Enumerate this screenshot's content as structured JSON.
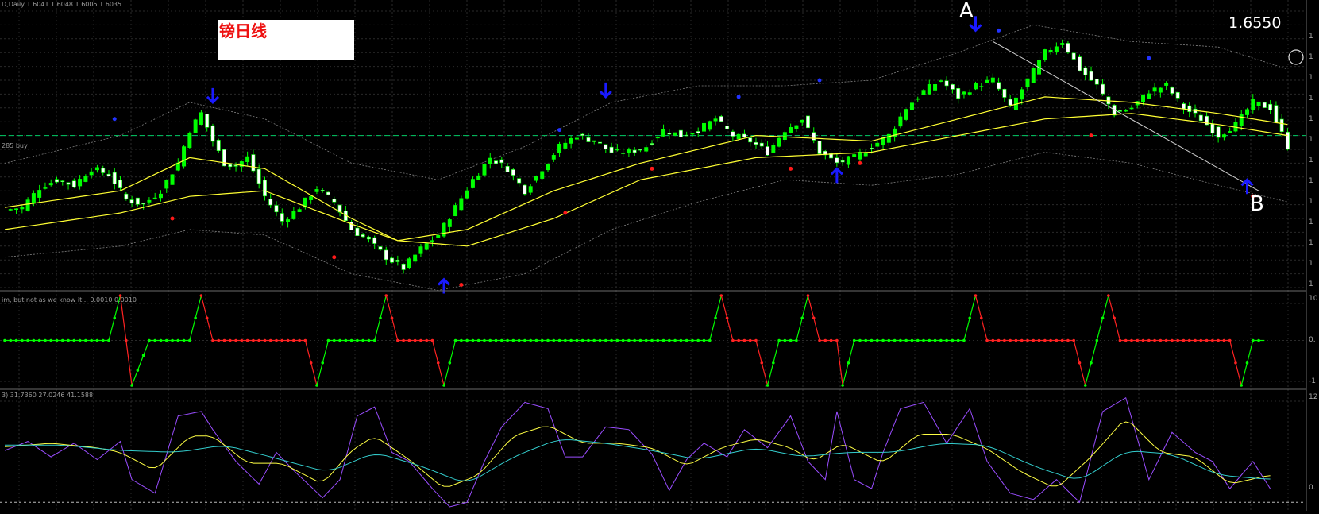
{
  "window": {
    "symbol_info": "D,Daily  1.6041 1.6048 1.6005 1.6035",
    "annotation_box": "镑日线",
    "price_label": "1.6550",
    "marker_a": "A",
    "marker_b": "B",
    "hline_label": "285 buy"
  },
  "indicator1": {
    "header": "im, but not as we know it...  0.0010  0.0010",
    "scale": [
      "10",
      "0.",
      "-1"
    ]
  },
  "indicator2": {
    "header": "3) 31.7360 27.0246 41.1588",
    "scale": [
      "12",
      "0."
    ]
  },
  "price_scale": [
    "1",
    "1",
    "1",
    "1",
    "1",
    "1",
    "1",
    "1",
    "1",
    "1",
    "1",
    "1",
    "1"
  ],
  "colors": {
    "background": "#000000",
    "grid": "#2a2a2a",
    "bull_candle": "#00ff00",
    "bear_candle": "#ffffff",
    "ma_yellow": "#ffff33",
    "band_dotted": "#808080",
    "signal_arrow": "#1a1aff",
    "dot_blue": "#2233ff",
    "dot_red": "#ff1a1a",
    "hline_green": "#00cc66",
    "hline_red": "#cc2222",
    "ind_green": "#00ff00",
    "ind_red": "#ff2222",
    "stoch_purple": "#9a4dff",
    "stoch_yellow": "#ffff44",
    "stoch_cyan": "#33cccc"
  },
  "chart_data": {
    "type": "candlestick",
    "close_path": [
      [
        0,
        1.585
      ],
      [
        3,
        1.5855
      ],
      [
        6,
        1.589
      ],
      [
        9,
        1.5905
      ],
      [
        12,
        1.5895
      ],
      [
        15,
        1.5925
      ],
      [
        18,
        1.5915
      ],
      [
        21,
        1.587
      ],
      [
        24,
        1.586
      ],
      [
        27,
        1.5885
      ],
      [
        30,
        1.5935
      ],
      [
        32,
        1.5995
      ],
      [
        34,
        1.6025
      ],
      [
        36,
        1.5975
      ],
      [
        38,
        1.5935
      ],
      [
        40,
        1.593
      ],
      [
        42,
        1.5945
      ],
      [
        45,
        1.5875
      ],
      [
        48,
        1.583
      ],
      [
        51,
        1.5855
      ],
      [
        54,
        1.589
      ],
      [
        57,
        1.5865
      ],
      [
        60,
        1.5815
      ],
      [
        63,
        1.5795
      ],
      [
        66,
        1.5765
      ],
      [
        69,
        1.5745
      ],
      [
        72,
        1.578
      ],
      [
        75,
        1.5805
      ],
      [
        78,
        1.5855
      ],
      [
        81,
        1.5905
      ],
      [
        84,
        1.5945
      ],
      [
        87,
        1.5925
      ],
      [
        90,
        1.5885
      ],
      [
        93,
        1.5925
      ],
      [
        96,
        1.5965
      ],
      [
        99,
        1.5985
      ],
      [
        102,
        1.5975
      ],
      [
        105,
        1.5955
      ],
      [
        108,
        1.5955
      ],
      [
        111,
        1.5965
      ],
      [
        114,
        1.5995
      ],
      [
        117,
        1.5985
      ],
      [
        120,
        1.5995
      ],
      [
        123,
        1.6015
      ],
      [
        126,
        1.5985
      ],
      [
        129,
        1.5975
      ],
      [
        132,
        1.5955
      ],
      [
        135,
        1.5995
      ],
      [
        138,
        1.6015
      ],
      [
        141,
        1.5955
      ],
      [
        144,
        1.5935
      ],
      [
        147,
        1.5945
      ],
      [
        150,
        1.5965
      ],
      [
        153,
        1.5985
      ],
      [
        156,
        1.6035
      ],
      [
        159,
        1.6065
      ],
      [
        162,
        1.6085
      ],
      [
        165,
        1.6055
      ],
      [
        168,
        1.6075
      ],
      [
        171,
        1.6085
      ],
      [
        174,
        1.6035
      ],
      [
        177,
        1.6085
      ],
      [
        180,
        1.6135
      ],
      [
        183,
        1.6155
      ],
      [
        186,
        1.6105
      ],
      [
        189,
        1.6075
      ],
      [
        192,
        1.6025
      ],
      [
        195,
        1.6035
      ],
      [
        198,
        1.6065
      ],
      [
        201,
        1.6075
      ],
      [
        204,
        1.6035
      ],
      [
        207,
        1.6015
      ],
      [
        210,
        1.5985
      ],
      [
        213,
        1.6005
      ],
      [
        216,
        1.6045
      ],
      [
        219,
        1.6035
      ],
      [
        222,
        1.5965
      ]
    ],
    "ma_fast": [
      [
        0,
        1.5855
      ],
      [
        20,
        1.5885
      ],
      [
        32,
        1.5945
      ],
      [
        45,
        1.5925
      ],
      [
        60,
        1.5835
      ],
      [
        68,
        1.5795
      ],
      [
        80,
        1.5815
      ],
      [
        95,
        1.5885
      ],
      [
        110,
        1.5935
      ],
      [
        130,
        1.5985
      ],
      [
        150,
        1.5975
      ],
      [
        165,
        1.6015
      ],
      [
        180,
        1.6055
      ],
      [
        195,
        1.6045
      ],
      [
        210,
        1.6025
      ],
      [
        222,
        1.6005
      ]
    ],
    "ma_slow": [
      [
        0,
        1.5815
      ],
      [
        20,
        1.5845
      ],
      [
        32,
        1.5875
      ],
      [
        45,
        1.5885
      ],
      [
        60,
        1.5825
      ],
      [
        68,
        1.5795
      ],
      [
        80,
        1.5785
      ],
      [
        95,
        1.5835
      ],
      [
        110,
        1.5905
      ],
      [
        130,
        1.5945
      ],
      [
        150,
        1.5955
      ],
      [
        165,
        1.5985
      ],
      [
        180,
        1.6015
      ],
      [
        195,
        1.6025
      ],
      [
        210,
        1.6005
      ],
      [
        222,
        1.5985
      ]
    ],
    "band_upper": [
      [
        0,
        1.5935
      ],
      [
        20,
        1.5985
      ],
      [
        32,
        1.6045
      ],
      [
        45,
        1.6015
      ],
      [
        60,
        1.5935
      ],
      [
        75,
        1.5905
      ],
      [
        90,
        1.5965
      ],
      [
        105,
        1.6045
      ],
      [
        120,
        1.6075
      ],
      [
        135,
        1.6075
      ],
      [
        150,
        1.6085
      ],
      [
        165,
        1.6135
      ],
      [
        178,
        1.6185
      ],
      [
        195,
        1.6155
      ],
      [
        210,
        1.6145
      ],
      [
        222,
        1.6105
      ]
    ],
    "band_lower": [
      [
        0,
        1.5765
      ],
      [
        20,
        1.5785
      ],
      [
        32,
        1.5815
      ],
      [
        45,
        1.5805
      ],
      [
        60,
        1.5735
      ],
      [
        75,
        1.5705
      ],
      [
        90,
        1.5735
      ],
      [
        105,
        1.5815
      ],
      [
        120,
        1.5865
      ],
      [
        135,
        1.5905
      ],
      [
        150,
        1.5895
      ],
      [
        165,
        1.5915
      ],
      [
        180,
        1.5955
      ],
      [
        195,
        1.5935
      ],
      [
        210,
        1.5895
      ],
      [
        222,
        1.5865
      ]
    ],
    "hline_green": 1.5985,
    "hline_red": 1.5975,
    "y_range": [
      1.571,
      1.621
    ],
    "x_range": [
      0,
      224
    ],
    "arrows_down": [
      [
        36,
        1.6045
      ],
      [
        104,
        1.6055
      ],
      [
        168,
        1.6175
      ]
    ],
    "arrows_up": [
      [
        76,
        1.5725
      ],
      [
        144,
        1.5925
      ],
      [
        215,
        1.5905
      ]
    ],
    "dots_blue": [
      [
        19,
        1.6015
      ],
      [
        96,
        1.5995
      ],
      [
        127,
        1.6055
      ],
      [
        141,
        1.6085
      ],
      [
        172,
        1.6175
      ],
      [
        198,
        1.6125
      ]
    ],
    "dots_red": [
      [
        29,
        1.5835
      ],
      [
        57,
        1.5765
      ],
      [
        79,
        1.5715
      ],
      [
        97,
        1.5845
      ],
      [
        112,
        1.5925
      ],
      [
        136,
        1.5925
      ],
      [
        148,
        1.5935
      ],
      [
        188,
        1.5985
      ],
      [
        216,
        1.5875
      ]
    ],
    "trendline": [
      [
        171,
        1.6155
      ],
      [
        217,
        1.5885
      ]
    ],
    "indicator1_line": [
      [
        0,
        0
      ],
      [
        18,
        0
      ],
      [
        20,
        10
      ],
      [
        22,
        -10
      ],
      [
        25,
        0
      ],
      [
        32,
        0
      ],
      [
        34,
        10
      ],
      [
        36,
        0
      ],
      [
        52,
        0
      ],
      [
        54,
        -10
      ],
      [
        56,
        0
      ],
      [
        64,
        0
      ],
      [
        66,
        10
      ],
      [
        68,
        0
      ],
      [
        74,
        0
      ],
      [
        76,
        -10
      ],
      [
        78,
        0
      ],
      [
        122,
        0
      ],
      [
        124,
        10
      ],
      [
        126,
        0
      ],
      [
        130,
        0
      ],
      [
        132,
        -10
      ],
      [
        134,
        0
      ],
      [
        137,
        0
      ],
      [
        139,
        10
      ],
      [
        141,
        0
      ],
      [
        144,
        0
      ],
      [
        145,
        -10
      ],
      [
        147,
        0
      ],
      [
        166,
        0
      ],
      [
        168,
        10
      ],
      [
        170,
        0
      ],
      [
        185,
        0
      ],
      [
        187,
        -10
      ],
      [
        189,
        0
      ],
      [
        191,
        10
      ],
      [
        193,
        0
      ],
      [
        212,
        0
      ],
      [
        214,
        -10
      ],
      [
        216,
        0
      ],
      [
        218,
        0
      ]
    ],
    "indicator2_purple": [
      [
        0,
        62
      ],
      [
        4,
        72
      ],
      [
        8,
        55
      ],
      [
        12,
        70
      ],
      [
        16,
        52
      ],
      [
        20,
        72
      ],
      [
        22,
        30
      ],
      [
        26,
        15
      ],
      [
        30,
        100
      ],
      [
        34,
        105
      ],
      [
        36,
        85
      ],
      [
        40,
        50
      ],
      [
        44,
        25
      ],
      [
        47,
        60
      ],
      [
        50,
        40
      ],
      [
        55,
        10
      ],
      [
        58,
        30
      ],
      [
        61,
        100
      ],
      [
        64,
        110
      ],
      [
        67,
        60
      ],
      [
        70,
        50
      ],
      [
        74,
        20
      ],
      [
        77,
        0
      ],
      [
        80,
        5
      ],
      [
        83,
        50
      ],
      [
        86,
        88
      ],
      [
        90,
        115
      ],
      [
        94,
        108
      ],
      [
        97,
        55
      ],
      [
        100,
        55
      ],
      [
        104,
        88
      ],
      [
        108,
        85
      ],
      [
        112,
        58
      ],
      [
        115,
        18
      ],
      [
        118,
        52
      ],
      [
        121,
        70
      ],
      [
        125,
        55
      ],
      [
        128,
        85
      ],
      [
        132,
        65
      ],
      [
        136,
        100
      ],
      [
        139,
        50
      ],
      [
        142,
        30
      ],
      [
        144,
        105
      ],
      [
        147,
        30
      ],
      [
        150,
        20
      ],
      [
        152,
        60
      ],
      [
        155,
        108
      ],
      [
        159,
        115
      ],
      [
        163,
        70
      ],
      [
        167,
        108
      ],
      [
        170,
        50
      ],
      [
        174,
        15
      ],
      [
        178,
        8
      ],
      [
        182,
        30
      ],
      [
        186,
        5
      ],
      [
        190,
        105
      ],
      [
        194,
        120
      ],
      [
        198,
        30
      ],
      [
        202,
        82
      ],
      [
        206,
        60
      ],
      [
        209,
        50
      ],
      [
        212,
        20
      ],
      [
        216,
        50
      ],
      [
        219,
        20
      ]
    ],
    "indicator2_yellow": [
      [
        0,
        66
      ],
      [
        8,
        70
      ],
      [
        16,
        65
      ],
      [
        20,
        60
      ],
      [
        26,
        40
      ],
      [
        32,
        78
      ],
      [
        36,
        78
      ],
      [
        42,
        48
      ],
      [
        48,
        48
      ],
      [
        55,
        25
      ],
      [
        60,
        62
      ],
      [
        64,
        78
      ],
      [
        70,
        52
      ],
      [
        76,
        20
      ],
      [
        82,
        35
      ],
      [
        88,
        78
      ],
      [
        94,
        90
      ],
      [
        100,
        70
      ],
      [
        106,
        70
      ],
      [
        112,
        65
      ],
      [
        118,
        45
      ],
      [
        124,
        65
      ],
      [
        130,
        75
      ],
      [
        136,
        65
      ],
      [
        140,
        50
      ],
      [
        145,
        70
      ],
      [
        152,
        48
      ],
      [
        158,
        80
      ],
      [
        164,
        80
      ],
      [
        170,
        64
      ],
      [
        176,
        38
      ],
      [
        182,
        20
      ],
      [
        188,
        55
      ],
      [
        194,
        98
      ],
      [
        200,
        60
      ],
      [
        206,
        55
      ],
      [
        212,
        25
      ],
      [
        219,
        35
      ]
    ],
    "indicator2_cyan": [
      [
        0,
        68
      ],
      [
        10,
        68
      ],
      [
        20,
        62
      ],
      [
        30,
        60
      ],
      [
        38,
        68
      ],
      [
        46,
        55
      ],
      [
        56,
        38
      ],
      [
        64,
        60
      ],
      [
        72,
        45
      ],
      [
        80,
        25
      ],
      [
        88,
        55
      ],
      [
        96,
        75
      ],
      [
        104,
        70
      ],
      [
        112,
        62
      ],
      [
        120,
        52
      ],
      [
        130,
        65
      ],
      [
        138,
        55
      ],
      [
        146,
        60
      ],
      [
        154,
        60
      ],
      [
        162,
        70
      ],
      [
        170,
        68
      ],
      [
        178,
        45
      ],
      [
        186,
        28
      ],
      [
        194,
        62
      ],
      [
        202,
        58
      ],
      [
        210,
        35
      ],
      [
        219,
        30
      ]
    ]
  }
}
